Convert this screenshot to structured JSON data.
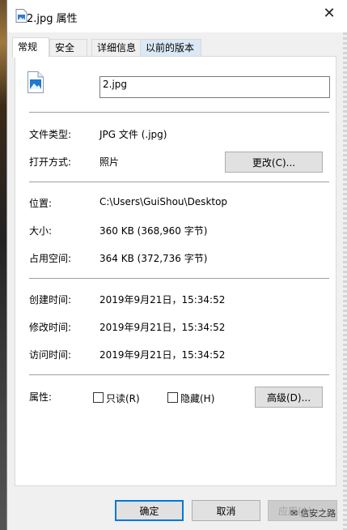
{
  "window": {
    "title": "2.jpg 属性",
    "close_icon": "close-icon"
  },
  "tabs": [
    "常规",
    "安全",
    "详细信息",
    "以前的版本"
  ],
  "file": {
    "name": "2.jpg",
    "icon": "image-file-icon"
  },
  "props": {
    "type_label": "文件类型:",
    "type_value": "JPG 文件 (.jpg)",
    "opens_label": "打开方式:",
    "opens_value": "照片",
    "change_button": "更改(C)...",
    "location_label": "位置:",
    "location_value": "C:\\Users\\GuiShou\\Desktop",
    "size_label": "大小:",
    "size_value": "360 KB (368,960 字节)",
    "disk_label": "占用空间:",
    "disk_value": "364 KB (372,736 字节)",
    "created_label": "创建时间:",
    "created_value": "2019年9月21日，15:34:52",
    "modified_label": "修改时间:",
    "modified_value": "2019年9月21日，15:34:52",
    "accessed_label": "访问时间:",
    "accessed_value": "2019年9月21日，15:34:52",
    "attr_label": "属性:",
    "readonly_label": "只读(R)",
    "hidden_label": "隐藏(H)",
    "advanced_button": "高级(D)..."
  },
  "footer": {
    "ok": "确定",
    "cancel": "取消",
    "apply": "应用(A)",
    "watermark": "信安之路"
  },
  "colors": {
    "accent": "#0078d7",
    "dialog_bg": "#f0f0f0",
    "panel_bg": "#ffffff"
  }
}
